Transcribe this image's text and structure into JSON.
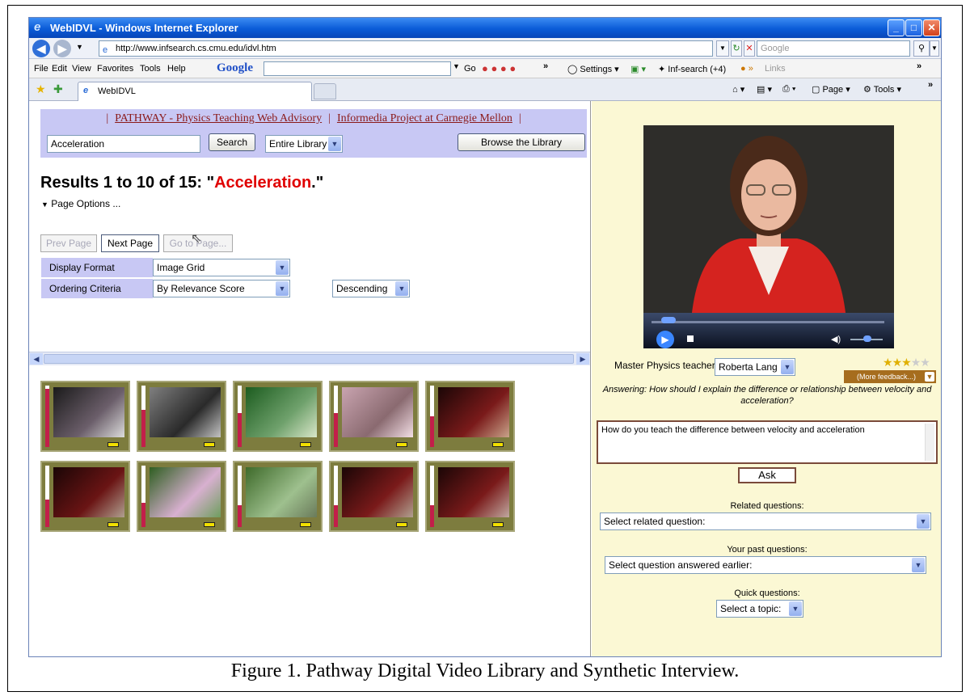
{
  "window": {
    "title": "WebIDVL - Windows Internet Explorer"
  },
  "addressbar": {
    "url": "http://www.infsearch.cs.cmu.edu/idvl.htm",
    "search_placeholder": "Google"
  },
  "menus": {
    "file": "File",
    "edit": "Edit",
    "view": "View",
    "favorites": "Favorites",
    "tools": "Tools",
    "help": "Help",
    "google": "Google",
    "go": "Go",
    "settings": "Settings",
    "infsearch": "Inf-search (+4)",
    "links": "Links"
  },
  "tabs": {
    "active": "WebIDVL",
    "page_menu": "Page",
    "tools_menu": "Tools"
  },
  "library": {
    "link_pathway": "PATHWAY - Physics Teaching Web Advisory",
    "link_informedia": "Informedia Project at Carnegie Mellon",
    "query": "Acceleration",
    "search_button": "Search",
    "scope": "Entire Library",
    "browse_button": "Browse the Library",
    "results_prefix": "Results 1 to 10 of 15: \"",
    "results_query": "Acceleration",
    "results_suffix": ".\"",
    "page_options": "Page Options ...",
    "prev_page": "Prev Page",
    "next_page": "Next Page",
    "go_to_page": "Go to Page...",
    "display_format_label": "Display Format",
    "display_format_value": "Image Grid",
    "ordering_label": "Ordering Criteria",
    "ordering_value": "By Relevance Score",
    "order_direction": "Descending",
    "thumbnails": [
      {
        "relevance": 0.95
      },
      {
        "relevance": 0.6
      },
      {
        "relevance": 0.55
      },
      {
        "relevance": 0.55
      },
      {
        "relevance": 0.5
      },
      {
        "relevance": 0.45
      },
      {
        "relevance": 0.4
      },
      {
        "relevance": 0.35
      },
      {
        "relevance": 0.35
      },
      {
        "relevance": 0.35
      }
    ]
  },
  "interview": {
    "teacher_label": "Master Physics teacher:",
    "teacher_value": "Roberta Lang",
    "rating_stars": 3,
    "rating_max": 5,
    "more_feedback": "(More feedback...)",
    "answering": "Answering: How should I explain the difference or relationship between velocity and acceleration?",
    "question_text": "How do you teach the difference between velocity and acceleration",
    "ask_button": "Ask",
    "related_label": "Related questions:",
    "related_value": "Select related question:",
    "past_label": "Your past questions:",
    "past_value": "Select question answered earlier:",
    "quick_label": "Quick questions:",
    "quick_value": "Select a topic:"
  },
  "caption": "Figure 1.  Pathway Digital Video Library and Synthetic Interview."
}
